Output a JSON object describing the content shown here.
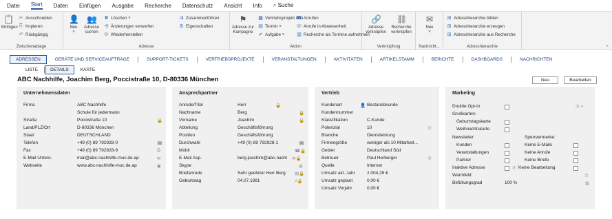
{
  "menu": [
    "Datei",
    "Start",
    "Daten",
    "Einfügen",
    "Ausgabe",
    "Recherche",
    "Datenschutz",
    "Ansicht",
    "Info",
    "Suche"
  ],
  "ribbon": {
    "clipboard": {
      "cut": "Ausschneiden",
      "copy": "Kopieren",
      "undo": "Rückgängig",
      "paste": "Einfügen",
      "label": "Zwischenablage"
    },
    "address": {
      "new": "Neu",
      "search": "Adresse suchen",
      "delete": "Löschen",
      "discard": "Änderungen verwerfen",
      "restore": "Wiederherstellen",
      "merge": "Zusammenführen",
      "props": "Eigenschaften",
      "label": "Adresse"
    },
    "action": {
      "campaign": "Adresse zur Kampagne",
      "project": "Vertriebsprojekt neu",
      "appointment": "Termin",
      "task": "Aufgabe",
      "call": "Anrufen",
      "call_absent": "Anrufe in Abwesenheit",
      "research_appt": "Recherche als Termine aufnehmen",
      "label": "Aktion"
    },
    "link": {
      "link_addr": "Adresse verknüpfen",
      "link_research": "Recherche verknüpfen",
      "label": "Verknüpfung"
    },
    "message": {
      "new": "Neu",
      "label": "Nachricht..."
    },
    "hierarchy": {
      "build": "Adresshierarchie bilden",
      "create": "Adresshierarchie erzeugen",
      "from_research": "Adresshierarchie aus Recherche",
      "label": "Adresshierarchie"
    }
  },
  "tabs": [
    "ADRESSEN",
    "GERÄTE UND SERVICEAUFTRÄGE",
    "SUPPORT-TICKETS",
    "VERTRIEBSPROJEKTE",
    "VERANSTALTUNGEN",
    "AKTIVITÄTEN",
    "ARTIKELSTAMM",
    "BERICHTE",
    "DASHBOARDS",
    "NACHRICHTEN"
  ],
  "subtabs": [
    "LISTE",
    "DETAILS",
    "KARTE"
  ],
  "title": "ABC Nachhilfe, Joachim Berg, Poccistraße 10, D-80336 München",
  "buttons": {
    "new": "Neu",
    "edit": "Bearbeiten"
  },
  "company": {
    "header": "Unternehmensdaten",
    "rows": [
      [
        "Firma",
        "ABC Nachhilfe"
      ],
      [
        "",
        "Schule für jedermann"
      ],
      [
        "Straße",
        "Poccistraße 10"
      ],
      [
        "Land/PLZ/Ort",
        "D-80336 München"
      ],
      [
        "Staat",
        "DEUTSCHLAND"
      ],
      [
        "Telefon",
        "+49 (0) 89 792928-0"
      ],
      [
        "Fax",
        "+49 (0) 89 792928-9"
      ],
      [
        "E-Mail Untern.",
        "mail@abc-nachhilfe-muc.de.ap"
      ],
      [
        "Webseite",
        "www.abc-nachhilfe-muc.de.ap"
      ]
    ]
  },
  "contact": {
    "header": "Ansprechpartner",
    "rows": [
      [
        "Anrede/Titel",
        "Herr"
      ],
      [
        "Nachname",
        "Berg"
      ],
      [
        "Vorname",
        "Joachim"
      ],
      [
        "Abteilung",
        "Geschäftsführung"
      ],
      [
        "Position",
        "Geschäftsführung"
      ],
      [
        "Durchwahl",
        "+49 (0) 89 792928-1"
      ],
      [
        "Mobil",
        ""
      ],
      [
        "E-Mail Asp.",
        "berg.joachim@abc-nachl"
      ],
      [
        "Skype",
        ""
      ],
      [
        "Briefanrede",
        "Sehr geehrter Herr Berg"
      ],
      [
        "Geburtstag",
        "04.07.1981"
      ]
    ]
  },
  "sales": {
    "header": "Vertrieb",
    "rows": [
      [
        "Kundenart",
        "Bestandskunde"
      ],
      [
        "Kundennummer",
        ""
      ],
      [
        "Klassifikation",
        "C-Kunde"
      ],
      [
        "Potenzial",
        "10"
      ],
      [
        "Branche",
        "Dienstleistung"
      ],
      [
        "Firmengröße",
        "weniger als 10 Mitarbeit..."
      ],
      [
        "Gebiet",
        "Deutschland Süd"
      ],
      [
        "Betreuer",
        "Paul Herberger"
      ],
      [
        "Quelle",
        "Internet"
      ],
      [
        "Umsatz akt. Jahr",
        "2.004,25 €"
      ],
      [
        "Umsatz geplant",
        "0,00 €"
      ],
      [
        "Umsatz Vorjahr",
        "0,00 €"
      ]
    ]
  },
  "marketing": {
    "header": "Marketing",
    "double_optin": "Double Opt-In",
    "greetings": "Grußkarten:",
    "birthday": "Geburtstagskarte",
    "christmas": "Weihnachtskarte",
    "newsletter": "Newsletter:",
    "blocks": "Sperrvermerke:",
    "customers": "Kunden",
    "events": "Veranstaltungen",
    "partners": "Partner",
    "no_emails": "Keine E-Mails",
    "no_calls": "Keine Anrufe",
    "no_letters": "Keine Briefe",
    "inactive": "Inaktive Adresse",
    "no_processing": "Keine Bearbeitung",
    "warmth": "Warmfeld",
    "fill": "Befüllungsgrad",
    "fill_value": "100 %"
  }
}
